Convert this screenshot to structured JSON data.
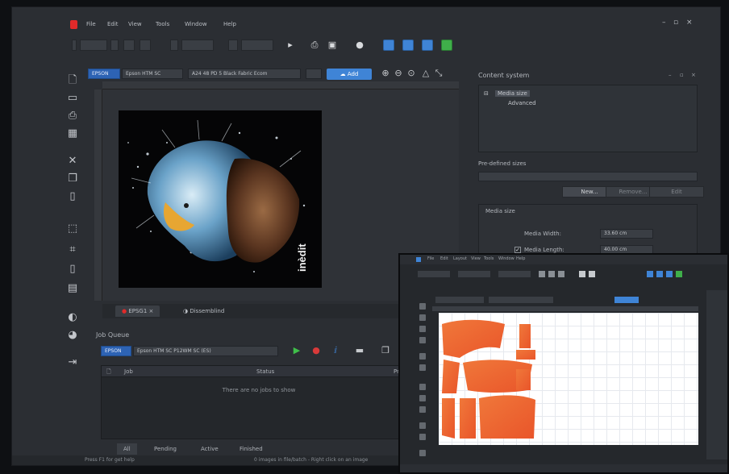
{
  "app": {
    "menu": [
      "File",
      "Edit",
      "View",
      "Tools",
      "Window",
      "Help"
    ]
  },
  "printer_bar": {
    "brand": "EPSON",
    "printer": "Epson HTM SC",
    "media": "A24 48 PD 5 Black Fabric Ecom",
    "add_label": "Add"
  },
  "doc_tabs": [
    {
      "label": "EPSG1",
      "active": true
    },
    {
      "label": "Dissemblind",
      "active": false
    }
  ],
  "photo": {
    "watermark": "inèdit"
  },
  "job_queue": {
    "title": "Job Queue",
    "brand": "EPSON",
    "printer": "Epson HTM SC P12WM SC (ES)",
    "columns": [
      "Job",
      "Status",
      "Progress"
    ],
    "empty_text": "There are no jobs to show",
    "tabs": [
      {
        "label": "All",
        "active": true
      },
      {
        "label": "Pending",
        "active": false
      },
      {
        "label": "Active",
        "active": false
      },
      {
        "label": "Finished",
        "active": false
      }
    ]
  },
  "status_bar": {
    "left": "Press F1 for get help",
    "middle": "0 images in file/batch - Right click on an image"
  },
  "right_panel": {
    "title": "Content system",
    "tree": [
      {
        "label": "Media size",
        "selected": true
      },
      {
        "label": "Advanced",
        "selected": false
      }
    ],
    "predefined_label": "Pre-defined sizes",
    "buttons": [
      {
        "label": "New...",
        "enabled": true
      },
      {
        "label": "Remove...",
        "enabled": false
      },
      {
        "label": "Edit",
        "enabled": false
      }
    ],
    "media_size": {
      "title": "Media size",
      "width_label": "Media Width:",
      "width_value": "33.60 cm",
      "length_label": "Media Length:",
      "length_value": "40.00 cm",
      "length_checked": true
    }
  },
  "inset": {
    "menu": [
      "File",
      "Edit",
      "Layout",
      "View",
      "Tools",
      "Window",
      "Help"
    ]
  },
  "colors": {
    "brand_blue": "#2d63b4",
    "accent_blue": "#3f84d6",
    "accent_green": "#3faf4a",
    "logo_red": "#e02a2a",
    "pattern_orange": "#ee6a2a",
    "play_green": "#3fbf4a",
    "stop_red": "#d83a3a"
  },
  "icons": [
    "new-file-icon",
    "open-folder-icon",
    "printer-icon",
    "save-icon",
    "close-icon",
    "copy-icon",
    "crop-icon",
    "contrast-icon",
    "zoom-in-icon",
    "zoom-out-icon",
    "play-icon",
    "stop-icon",
    "gear-icon",
    "minimize-icon",
    "maximize-icon",
    "close-window-icon"
  ]
}
